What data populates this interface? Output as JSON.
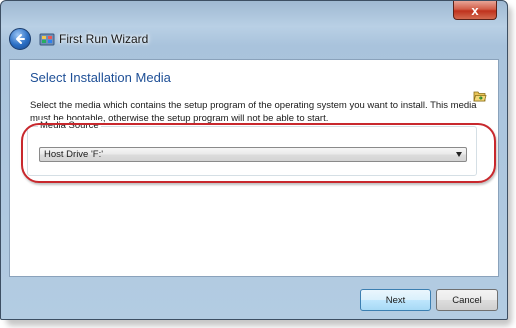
{
  "window": {
    "title": "First Run Wizard",
    "close_label": "x"
  },
  "page": {
    "heading": "Select Installation Media",
    "description": "Select the media which contains the setup program of the operating system you want to install. This media must be bootable, otherwise the setup program will not be able to start."
  },
  "media_source": {
    "label": "Media Source",
    "selected": "Host Drive 'F:'"
  },
  "buttons": {
    "next": "Next",
    "cancel": "Cancel"
  },
  "icons": {
    "back": "back-arrow-icon",
    "app": "virtualbox-icon",
    "folder": "open-folder-icon",
    "dropdown": "chevron-down-icon"
  },
  "colors": {
    "heading": "#1e4f96",
    "highlight": "#c8282d",
    "close": "#c0321d"
  }
}
